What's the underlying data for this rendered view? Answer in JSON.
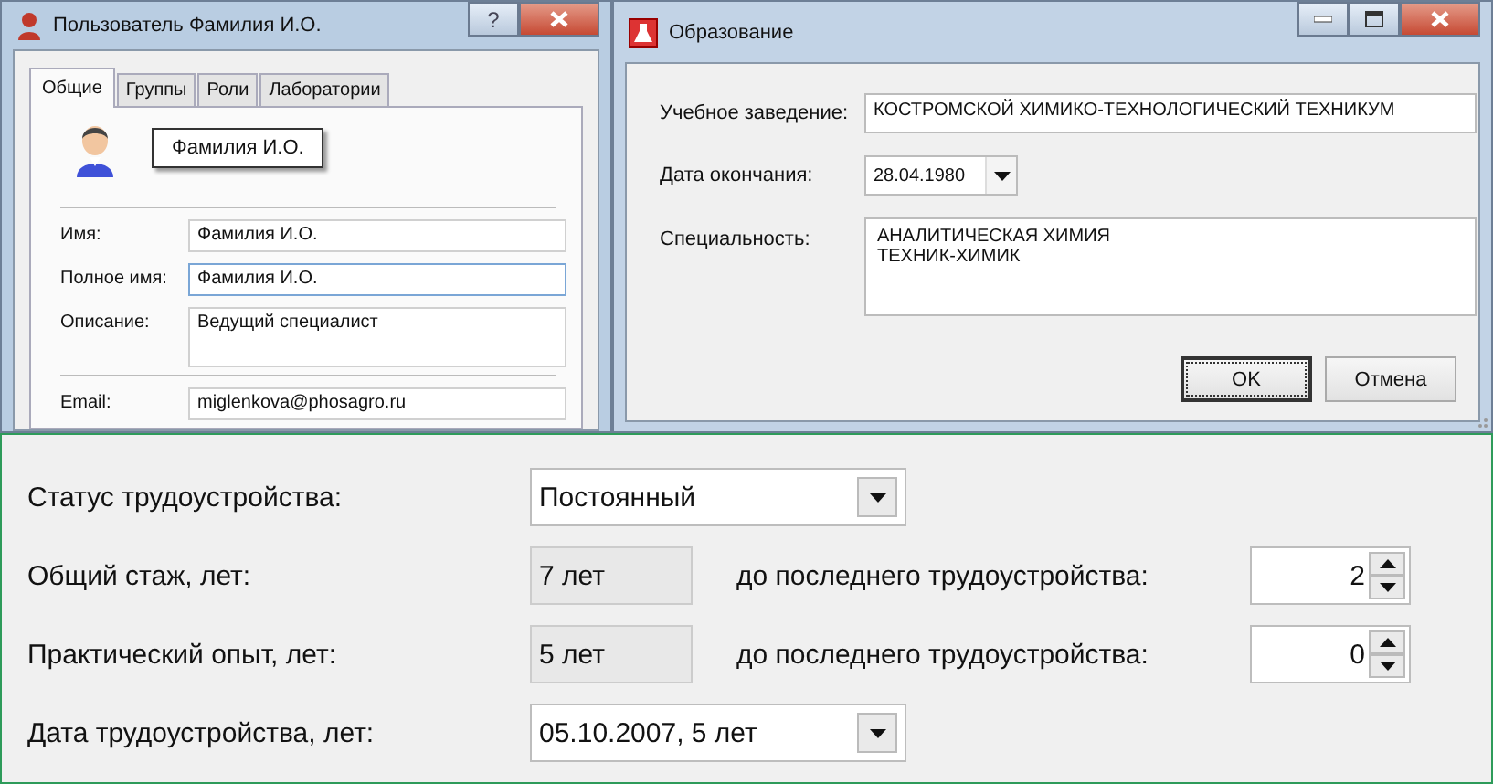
{
  "user_window": {
    "title": "Пользователь Фамилия И.О.",
    "help_button": "?",
    "tabs": [
      {
        "label": "Общие",
        "selected": true
      },
      {
        "label": "Группы",
        "selected": false
      },
      {
        "label": "Роли",
        "selected": false
      },
      {
        "label": "Лаборатории",
        "selected": false
      }
    ],
    "display_name": "Фамилия И.О.",
    "field_groups": [
      [
        {
          "kind": "input",
          "label": "Имя:",
          "value": "Фамилия И.О.",
          "focused": false
        },
        {
          "kind": "input",
          "label": "Полное имя:",
          "value": "Фамилия И.О.",
          "focused": true
        },
        {
          "kind": "textarea",
          "label": "Описание:",
          "value": "Ведущий специалист",
          "focused": false
        }
      ],
      [
        {
          "kind": "input",
          "label": "Email:",
          "value": "miglenkova@phosagro.ru",
          "focused": false
        }
      ]
    ]
  },
  "education_window": {
    "title": "Образование",
    "fields": [
      {
        "kind": "input",
        "label": "Учебное заведение:",
        "value": "КОСТРОМСКОЙ ХИМИКО-ТЕХНОЛОГИЧЕСКИЙ ТЕХНИКУМ"
      },
      {
        "kind": "date",
        "label": "Дата окончания:",
        "value": "28.04.1980"
      },
      {
        "kind": "textarea",
        "label": "Специальность:",
        "lines": [
          "АНАЛИТИЧЕСКАЯ ХИМИЯ",
          "ТЕХНИК-ХИМИК"
        ]
      }
    ],
    "buttons": [
      {
        "label": "OK",
        "default": true
      },
      {
        "label": "Отмена",
        "default": false
      }
    ]
  },
  "employment": {
    "rows": [
      {
        "kind": "combo",
        "label": "Статус трудоустройства:",
        "value": "Постоянный"
      },
      {
        "kind": "readonly",
        "label": "Общий стаж, лет:",
        "value": "7 лет",
        "extra_label": "до последнего трудоустройства:",
        "spin_value": "2"
      },
      {
        "kind": "readonly",
        "label": "Практический опыт, лет:",
        "value": "5 лет",
        "extra_label": "до последнего трудоустройства:",
        "spin_value": "0"
      },
      {
        "kind": "combo",
        "label": "Дата трудоустройства, лет:",
        "value": "05.10.2007, 5 лет"
      }
    ]
  }
}
